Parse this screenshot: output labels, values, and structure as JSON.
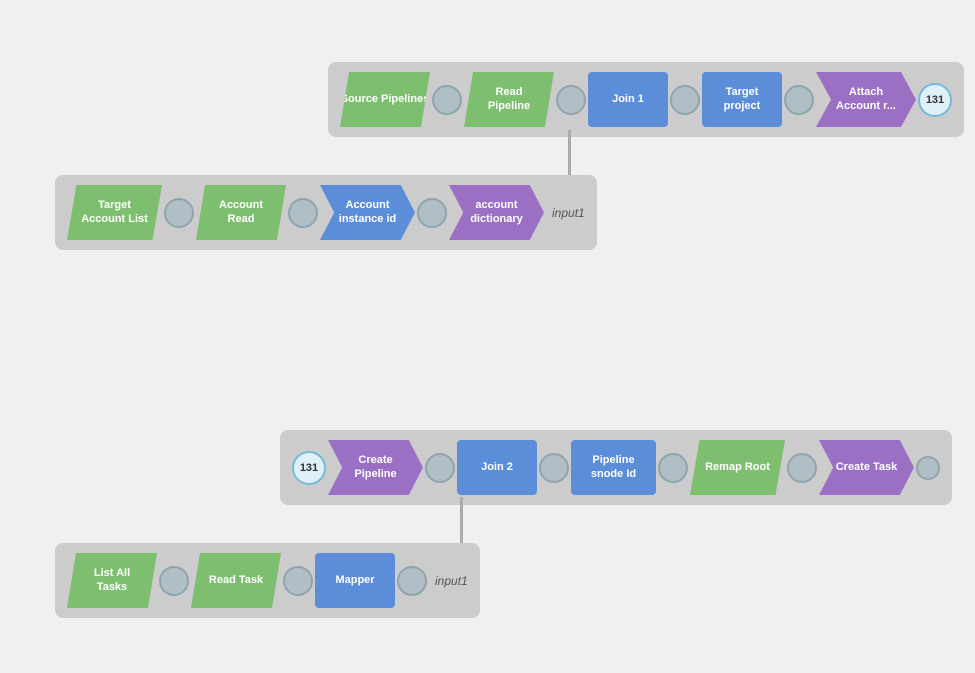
{
  "pipeline1": {
    "row1": {
      "nodes": [
        {
          "id": "source-pipelines",
          "label": "Source\nPipelines",
          "shape": "parallelogram",
          "color": "green"
        },
        {
          "id": "read-pipeline",
          "label": "Read\nPipeline",
          "shape": "parallelogram",
          "color": "green"
        },
        {
          "id": "join1",
          "label": "Join 1",
          "shape": "square",
          "color": "blue"
        },
        {
          "id": "target-project",
          "label": "Target\nproject",
          "shape": "square",
          "color": "blue"
        },
        {
          "id": "attach-account-r",
          "label": "Attach\nAccount r...",
          "shape": "arrow",
          "color": "purple"
        }
      ],
      "badge": "131"
    },
    "row2": {
      "nodes": [
        {
          "id": "target-account-list",
          "label": "Target\nAccount List",
          "shape": "parallelogram",
          "color": "green"
        },
        {
          "id": "account-read",
          "label": "Account\nRead",
          "shape": "parallelogram",
          "color": "green"
        },
        {
          "id": "account-instance-id",
          "label": "Account\ninstance id",
          "shape": "arrow",
          "color": "blue"
        },
        {
          "id": "account-dictionary",
          "label": "account\ndictionary",
          "shape": "arrow",
          "color": "purple"
        }
      ],
      "input_label": "input1"
    }
  },
  "pipeline2": {
    "row1": {
      "badge": "131",
      "nodes": [
        {
          "id": "create-pipeline",
          "label": "Create\nPipeline",
          "shape": "arrow",
          "color": "purple"
        },
        {
          "id": "join2",
          "label": "Join 2",
          "shape": "square",
          "color": "blue"
        },
        {
          "id": "pipeline-snode-id",
          "label": "Pipeline\nsnode Id",
          "shape": "square",
          "color": "blue"
        },
        {
          "id": "remap-root",
          "label": "Remap Root",
          "shape": "parallelogram",
          "color": "green"
        },
        {
          "id": "create-task",
          "label": "Create Task",
          "shape": "arrow",
          "color": "purple"
        }
      ]
    },
    "row2": {
      "nodes": [
        {
          "id": "list-all-tasks",
          "label": "List All\nTasks",
          "shape": "parallelogram",
          "color": "green"
        },
        {
          "id": "read-task",
          "label": "Read Task",
          "shape": "parallelogram",
          "color": "green"
        },
        {
          "id": "mapper",
          "label": "Mapper",
          "shape": "square",
          "color": "blue"
        }
      ],
      "input_label": "input1"
    }
  }
}
